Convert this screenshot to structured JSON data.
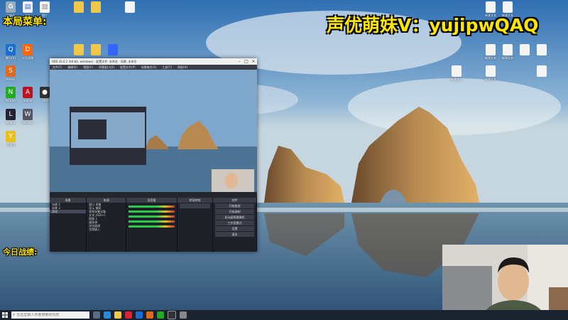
{
  "overlay": {
    "menu_label": "本局菜单:",
    "results_label": "今日战绩:",
    "streamer_handle": "声优萌妹V：yujipwQAQ"
  },
  "obs": {
    "title": "OBS 26.0.2 (64-bit, windows) - 配置文件: 未命名 - 场景: 未命名",
    "menu": [
      "文件(F)",
      "编辑(E)",
      "视图(V)",
      "停靠窗口(D)",
      "配置文件(P)",
      "场景集合(S)",
      "工具(T)",
      "帮助(H)"
    ],
    "docks": {
      "scenes_header": "场景",
      "scenes": [
        "场景 2",
        "场景 3",
        "游戏"
      ],
      "sources_header": "来源",
      "sources": [
        "窗口 采集",
        "显示 捕获",
        "视频采集设备",
        "文本 (GDI+)",
        "图像 2",
        "媒体源",
        "浏览器源",
        "音频输入"
      ],
      "mixer_header": "混音器",
      "transitions_header": "转场特效",
      "controls_header": "控件",
      "controls": [
        "开始推流",
        "开始录制",
        "启动虚拟摄像机",
        "工作室模式",
        "设置",
        "退出"
      ],
      "status": "LIVE: 00:00:00  REC: 00:00:00  CPU: 4.3%, 30.00 fps"
    }
  },
  "taskbar": {
    "search_placeholder": "在这里输入你要搜索的内容"
  },
  "colors": {
    "overlay_yellow": "#ffe600",
    "obs_bg": "#2b2e38",
    "taskbar": "#1b2330"
  },
  "desktop_icons": {
    "left_column_1": [
      "回收站",
      "腾讯QQ",
      "Steam",
      "Yy语音",
      "NVIDIA",
      "League"
    ],
    "left_column_2": [
      "文档",
      "斗鱼直播",
      "图片",
      "OBS",
      "Adobe",
      "WeGame"
    ],
    "right_column": [
      "新建文本",
      "新建文本",
      "新建文本",
      "新建文本",
      "新建文本",
      "新建文本"
    ]
  }
}
